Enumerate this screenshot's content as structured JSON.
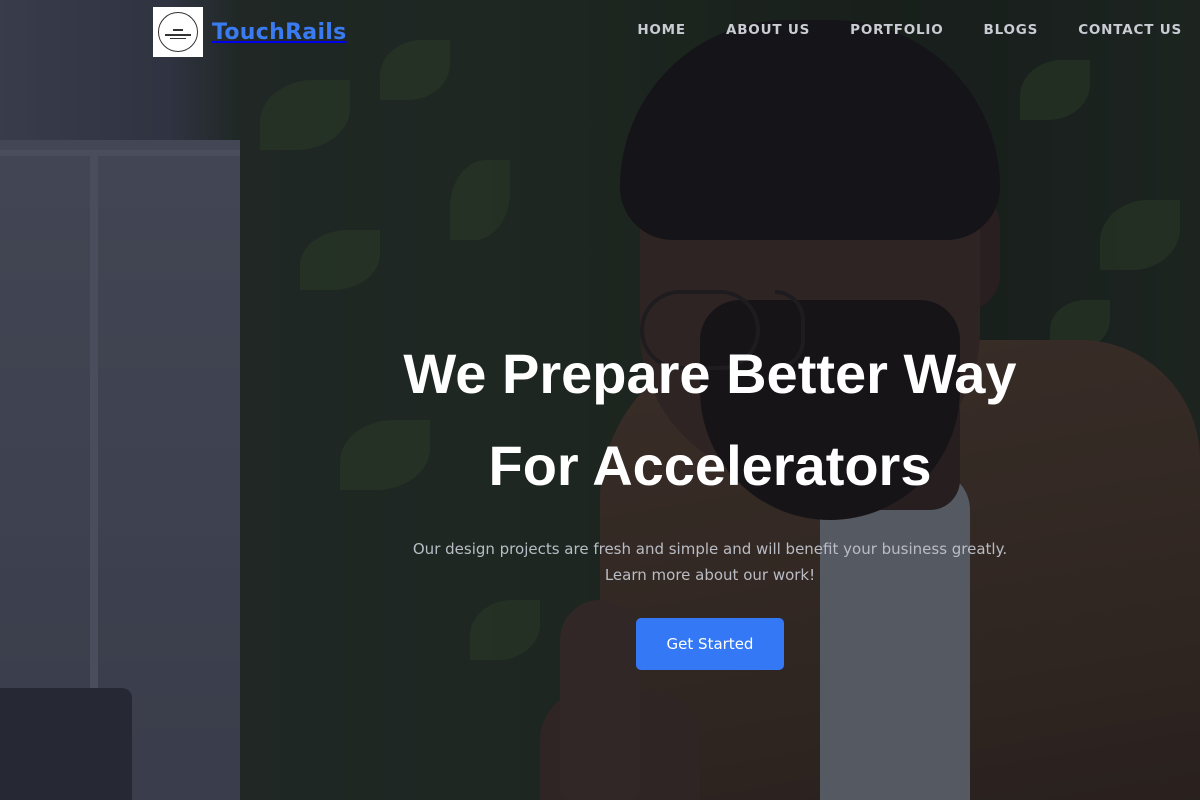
{
  "brand": {
    "name": "TouchRails",
    "logo_icon": "company-seal-logo"
  },
  "nav": {
    "items": [
      "HOME",
      "ABOUT US",
      "PORTFOLIO",
      "BLOGS",
      "CONTACT US"
    ]
  },
  "hero": {
    "title_line1": "We Prepare Better Way",
    "title_line2": "For Accelerators",
    "subtitle": "Our design projects are fresh and simple and will benefit your business greatly. Learn more about our work!",
    "cta_label": "Get Started"
  },
  "colors": {
    "accent": "#3478f6",
    "brand": "#3b7bf2",
    "nav_text": "#c9ccd3"
  }
}
